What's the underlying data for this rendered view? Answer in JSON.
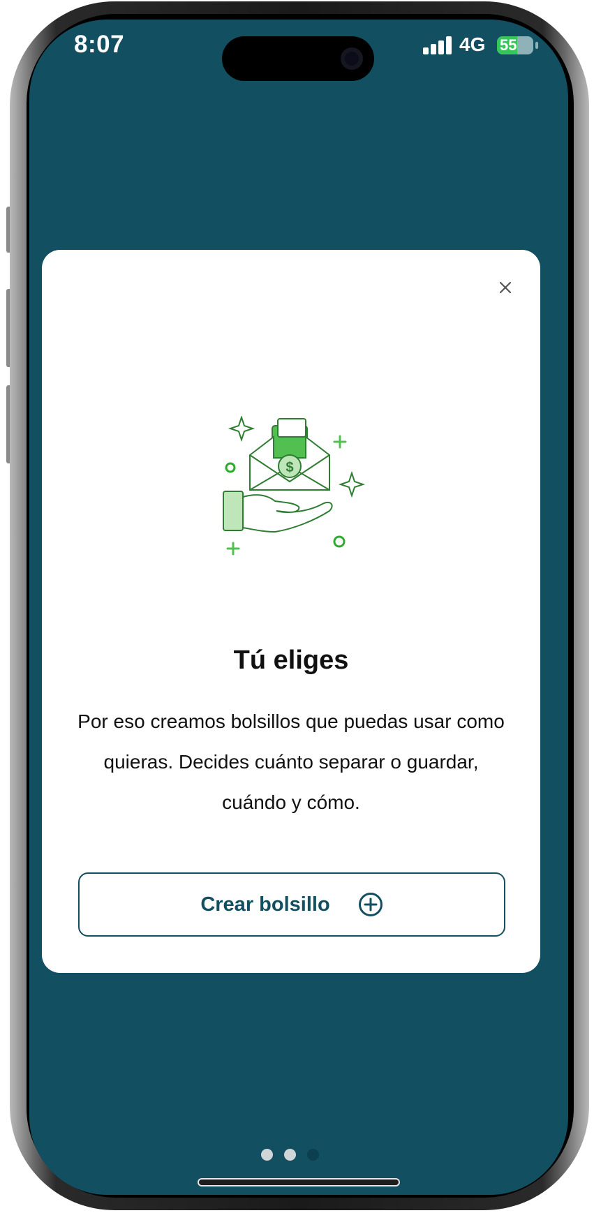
{
  "status_bar": {
    "time": "8:07",
    "network": "4G",
    "battery": "55",
    "battery_level": 0.55
  },
  "modal": {
    "close_icon": "close-icon",
    "illustration": "hand-holding-money-envelope-illustration",
    "title": "Tú eliges",
    "description": "Por eso creamos bolsillos que puedas usar como quieras. Decides cuánto separar o guardar, cuándo y cómo.",
    "cta_label": "Crear bolsillo",
    "cta_icon": "plus-circle-icon"
  },
  "pagination": {
    "total": 3,
    "active_index": 2
  },
  "colors": {
    "background": "#124f61",
    "card": "#ffffff",
    "accent": "#124f61",
    "illustration_green": "#2e9b3d"
  }
}
